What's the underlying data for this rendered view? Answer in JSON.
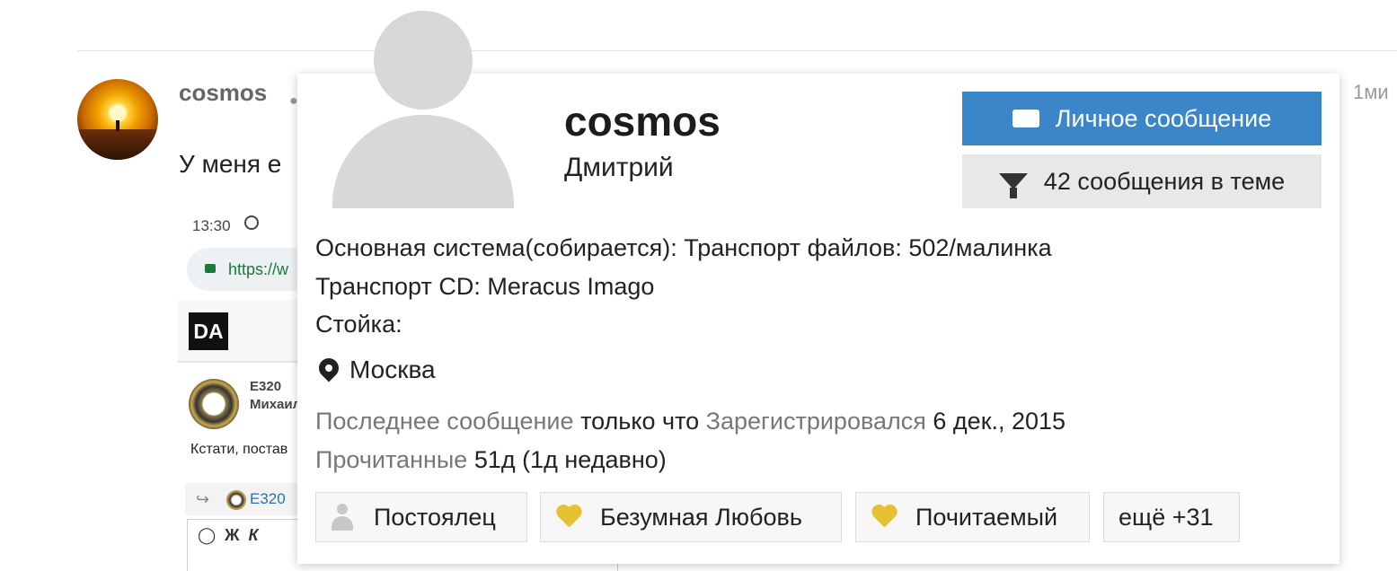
{
  "post": {
    "author": "cosmos",
    "time": "1ми",
    "text": "У меня е"
  },
  "screenshot": {
    "time": "13:30",
    "url": "https://w",
    "logo": "DA",
    "user1": "E320",
    "user2": "Михаил",
    "text": "Кстати, постав",
    "quote_user": "E320",
    "tb_bold": "Ж",
    "tb_italic": "К"
  },
  "card": {
    "username": "cosmos",
    "real_name": "Дмитрий",
    "message_button": "Личное сообщение",
    "posts_button": "42 сообщения в теме",
    "system_line": "Основная система(собирается): Транспорт файлов: 502/малинка",
    "cd_line": "Транспорт CD: Meracus Imago",
    "rack_line": "Стойка:",
    "location": "Москва",
    "last_post_label": "Последнее сообщение",
    "last_post_value": "только что",
    "registered_label": "Зарегистрировался",
    "registered_value": "6 дек., 2015",
    "read_label": "Прочитанные",
    "read_value": "51д (1д недавно)",
    "tags": [
      {
        "label": "Постоялец",
        "icon": "user-icon"
      },
      {
        "label": "Безумная Любовь",
        "icon": "heart-icon"
      },
      {
        "label": "Почитаемый",
        "icon": "heart-icon"
      },
      {
        "label": "ещё +31"
      }
    ]
  },
  "colors": {
    "accent": "#3b86c9",
    "heart": "#e6c134"
  }
}
